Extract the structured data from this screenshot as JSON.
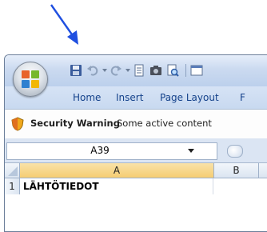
{
  "annotation": {
    "arrow_color": "#1f4fe0"
  },
  "ribbon": {
    "tabs": [
      "Home",
      "Insert",
      "Page Layout",
      "F"
    ]
  },
  "security_bar": {
    "title": "Security Warning",
    "message": "Some active content"
  },
  "formula_bar": {
    "name_box_value": "A39"
  },
  "grid": {
    "columns": [
      "A",
      "B"
    ],
    "rows": [
      {
        "number": "1",
        "a": "LÄHTÖTIEDOT"
      }
    ]
  },
  "colors": {
    "title_gradient_top": "#e6eefa",
    "tab_text": "#15428b",
    "selected_column_header": "#f5cd72"
  }
}
